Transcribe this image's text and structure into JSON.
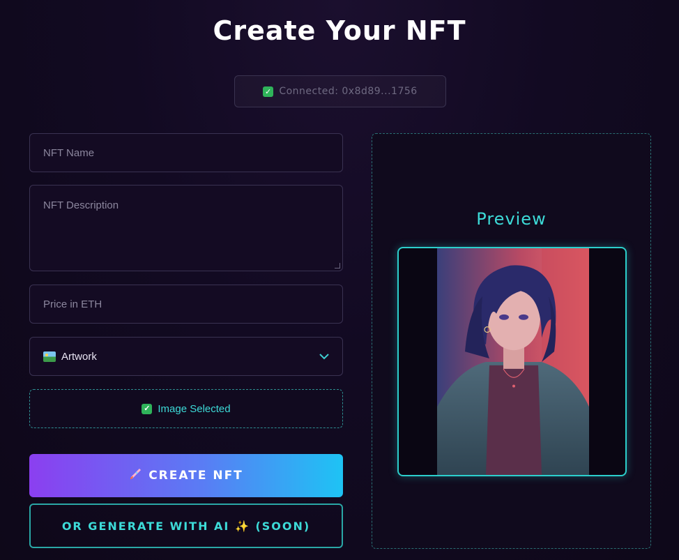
{
  "page": {
    "title": "Create Your NFT"
  },
  "wallet": {
    "status_text": "Connected: 0x8d89...1756",
    "status_icon": "check-icon"
  },
  "form": {
    "name_placeholder": "NFT Name",
    "description_placeholder": "NFT Description",
    "price_placeholder": "Price in ETH",
    "category_selected": "Artwork",
    "category_icon": "framed-picture-icon",
    "upload_status": "Image Selected"
  },
  "actions": {
    "create_label": "CREATE NFT",
    "create_icon": "rocket-icon",
    "ai_label": "OR GENERATE WITH AI ✨ (SOON)"
  },
  "preview": {
    "title": "Preview"
  },
  "colors": {
    "accent_cyan": "#3ddbd8",
    "gradient_start": "#8b3ff0",
    "gradient_end": "#1ec3f4",
    "background": "#120a22"
  }
}
